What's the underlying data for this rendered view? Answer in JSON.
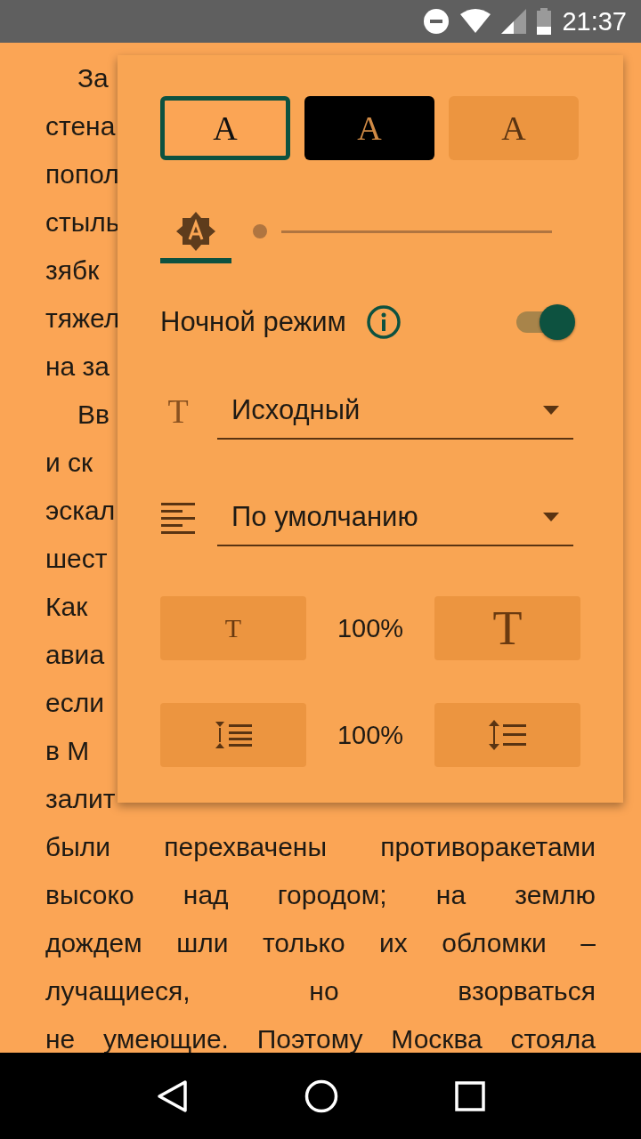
{
  "status_bar": {
    "time": "21:37"
  },
  "reader": {
    "lines": [
      {
        "text": "За",
        "indent": true
      },
      {
        "text": "стена",
        "indent": false
      },
      {
        "text": "попол",
        "indent": false
      },
      {
        "text": "стыль",
        "indent": false
      },
      {
        "text": "зябк",
        "indent": false
      },
      {
        "text": "тяжел",
        "indent": false
      },
      {
        "text": "на за",
        "indent": false
      },
      {
        "text": "Вв",
        "indent": true
      },
      {
        "text": "и ск",
        "indent": false
      },
      {
        "text": "эскал",
        "indent": false
      },
      {
        "text": "шест",
        "indent": false
      },
      {
        "text": "Как",
        "indent": false
      },
      {
        "text": "авиа",
        "indent": false
      },
      {
        "text": "если",
        "indent": false
      },
      {
        "text": "в М",
        "indent": false
      },
      {
        "text": "залит",
        "indent": false
      },
      {
        "text": "были перехвачены противоракетами",
        "indent": false
      },
      {
        "text": "высоко над городом; на землю",
        "indent": false
      },
      {
        "text": "дождем шли только их обломки –",
        "indent": false
      },
      {
        "text": "лучащиеся, но взорваться",
        "indent": false
      },
      {
        "text": "не умеющие. Поэтому Москва стояла",
        "indent": false
      }
    ]
  },
  "settings_panel": {
    "themes": [
      {
        "label": "A",
        "kind": "light",
        "selected": true
      },
      {
        "label": "A",
        "kind": "dark",
        "selected": false
      },
      {
        "label": "A",
        "kind": "sepia",
        "selected": false
      }
    ],
    "brightness": {
      "auto": true,
      "level": 0
    },
    "night_mode": {
      "label": "Ночной режим",
      "on": true
    },
    "font": {
      "icon_label": "T",
      "value": "Исходный"
    },
    "alignment": {
      "value": "По умолчанию"
    },
    "font_size": {
      "decrease_label": "T",
      "value": "100%",
      "increase_label": "T"
    },
    "line_spacing": {
      "value": "100%"
    }
  }
}
